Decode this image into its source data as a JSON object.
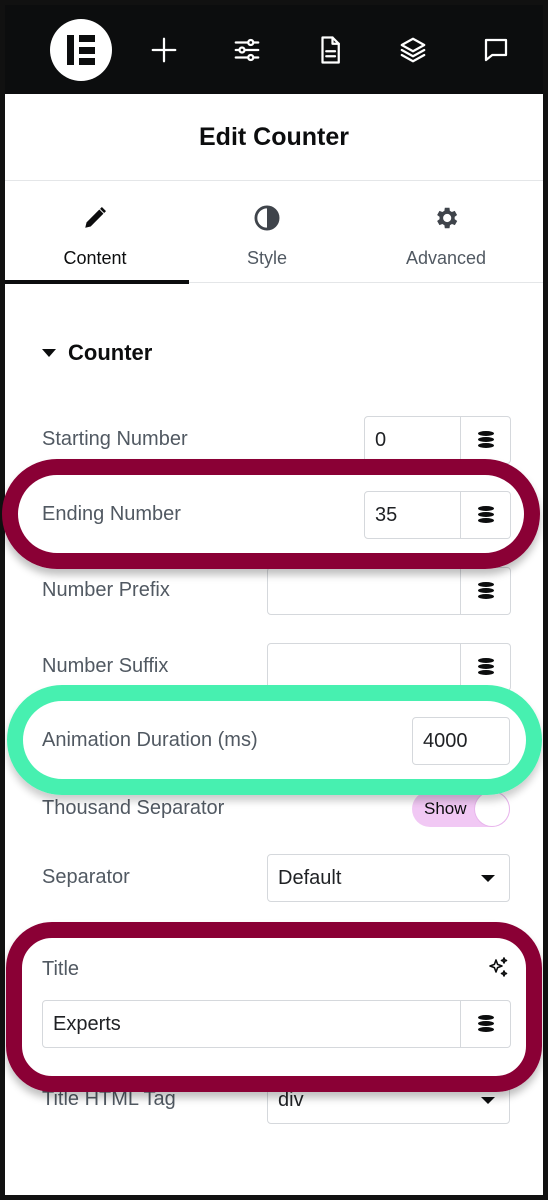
{
  "toolbar": {
    "logo_icon": "elementor-logo-icon",
    "icons": [
      "plus-icon",
      "sliders-icon",
      "document-icon",
      "layers-icon",
      "chat-icon"
    ]
  },
  "panel": {
    "title": "Edit Counter"
  },
  "tabs": [
    {
      "label": "Content",
      "icon": "pencil-icon",
      "active": true
    },
    {
      "label": "Style",
      "icon": "half-circle-icon",
      "active": false
    },
    {
      "label": "Advanced",
      "icon": "gear-icon",
      "active": false
    }
  ],
  "section": {
    "title": "Counter"
  },
  "controls": {
    "starting_number": {
      "label": "Starting Number",
      "value": "0"
    },
    "ending_number": {
      "label": "Ending Number",
      "value": "35"
    },
    "number_prefix": {
      "label": "Number Prefix",
      "value": ""
    },
    "number_suffix": {
      "label": "Number Suffix",
      "value": ""
    },
    "animation_duration": {
      "label": "Animation Duration (ms)",
      "value": "4000"
    },
    "thousand_separator": {
      "label": "Thousand Separator",
      "toggle_text": "Show",
      "on": true
    },
    "separator": {
      "label": "Separator",
      "value": "Default"
    },
    "title": {
      "label": "Title",
      "value": "Experts"
    },
    "title_html_tag": {
      "label": "Title HTML Tag",
      "value": "div"
    }
  },
  "colors": {
    "highlight_red": "#8a0035",
    "highlight_green": "#47f0b0",
    "toggle_on": "#f1c8f4",
    "topbar": "#0c0d0e"
  }
}
